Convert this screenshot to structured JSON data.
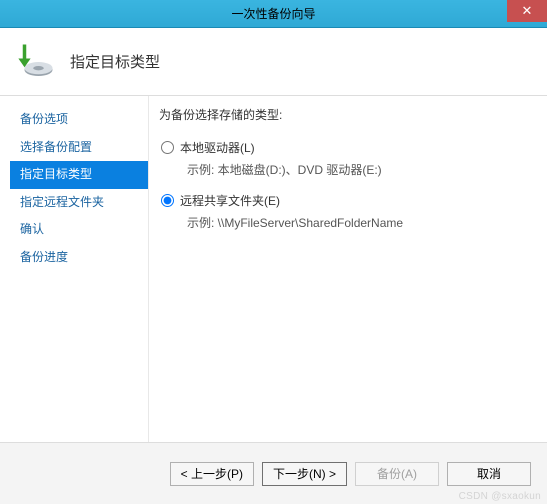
{
  "titlebar": {
    "text": "一次性备份向导"
  },
  "header": {
    "title": "指定目标类型"
  },
  "sidebar": {
    "items": [
      {
        "label": "备份选项",
        "active": false
      },
      {
        "label": "选择备份配置",
        "active": false
      },
      {
        "label": "指定目标类型",
        "active": true
      },
      {
        "label": "指定远程文件夹",
        "active": false
      },
      {
        "label": "确认",
        "active": false
      },
      {
        "label": "备份进度",
        "active": false
      }
    ]
  },
  "main": {
    "heading": "为备份选择存储的类型:",
    "options": [
      {
        "label": "本地驱动器(L)",
        "example": "示例: 本地磁盘(D:)、DVD 驱动器(E:)",
        "selected": false
      },
      {
        "label": "远程共享文件夹(E)",
        "example": "示例: \\\\MyFileServer\\SharedFolderName",
        "selected": true
      }
    ]
  },
  "footer": {
    "prev": "< 上一步(P)",
    "next": "下一步(N) >",
    "backup": "备份(A)",
    "cancel": "取消"
  },
  "watermark": "CSDN @sxaokun"
}
